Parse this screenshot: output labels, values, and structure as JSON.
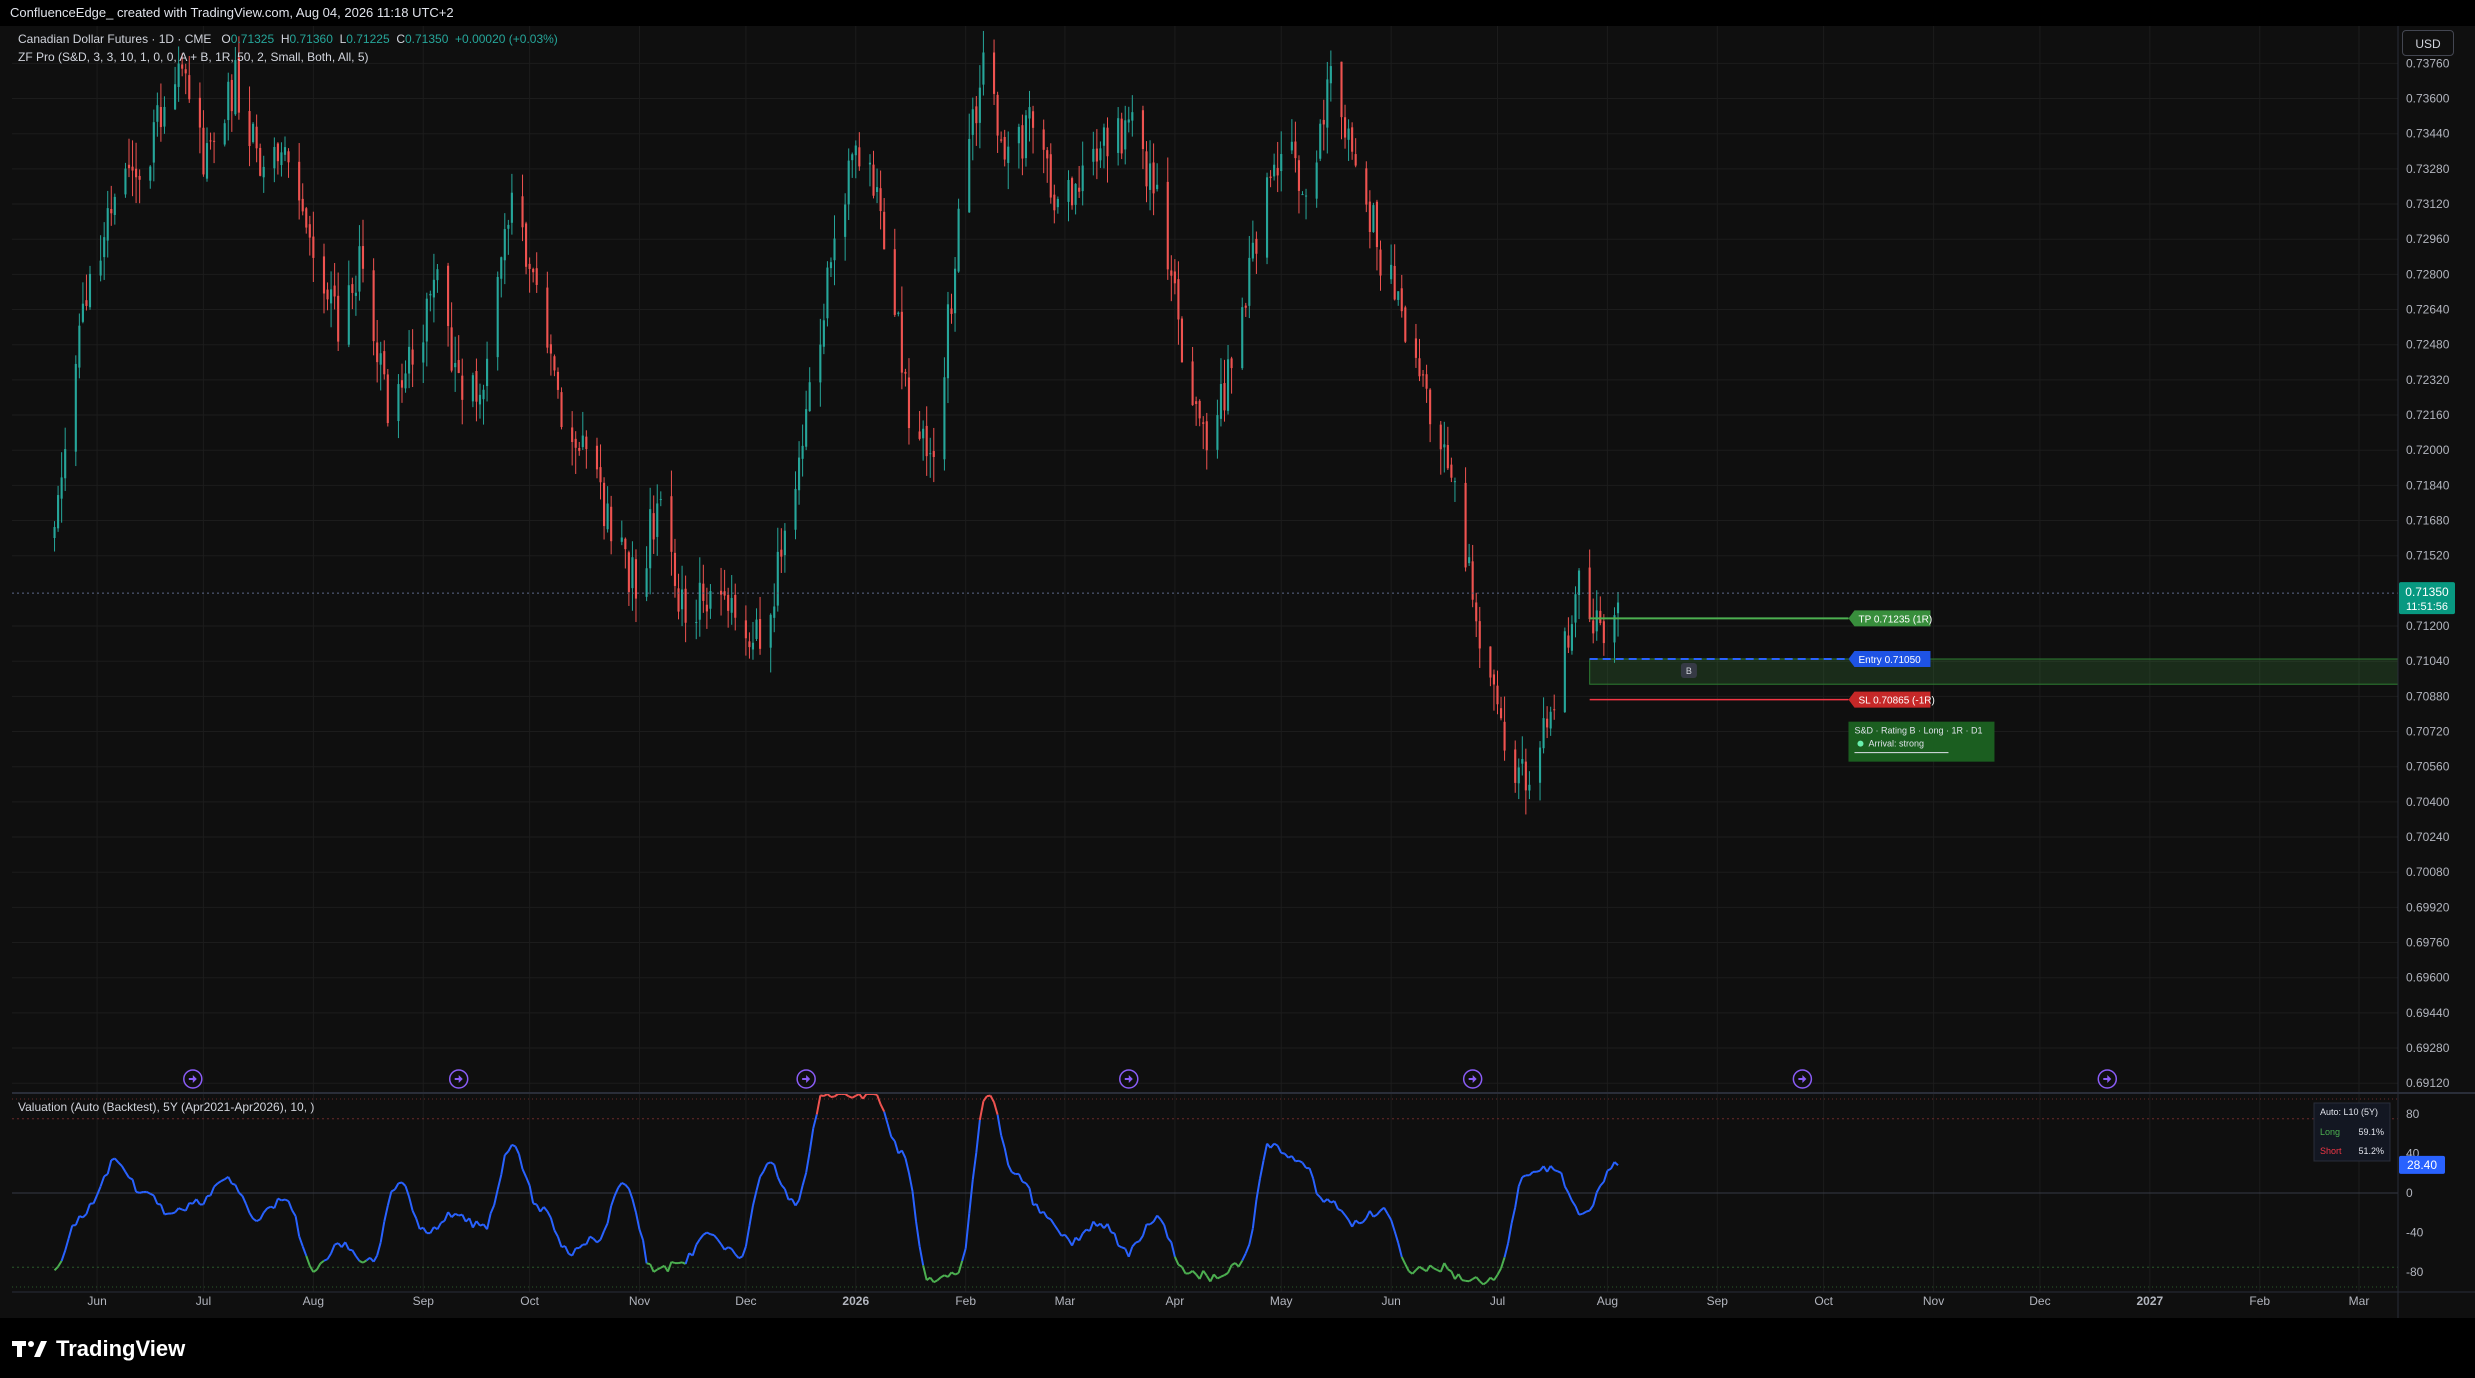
{
  "header": {
    "title": "ConfluenceEdge_ created with TradingView.com, Aug 04, 2026 11:18 UTC+2"
  },
  "legend": {
    "symbol": "Canadian Dollar Futures · 1D · CME",
    "o_label": "O",
    "o": "0.71325",
    "h_label": "H",
    "h": "0.71360",
    "l_label": "L",
    "l": "0.71225",
    "c_label": "C",
    "c": "0.71350",
    "change": "+0.00020 (+0.03%)",
    "indicator": "ZF Pro (S&D, 3, 3, 10, 1, 0, 0, A + B, 1R, 50, 2, Small, Both, All, 5)"
  },
  "currency_button": "USD",
  "footer": {
    "logo_text": "TradingView"
  },
  "colors": {
    "up": "#26a69a",
    "down": "#ef5350",
    "tp": "#4caf50",
    "entry": "#2962ff",
    "sl": "#f23645",
    "osc": "#2962ff",
    "accent": "#8a5cf6"
  },
  "chart_data": [
    {
      "type": "candlestick",
      "y_ticks": [
        "0.73760",
        "0.73600",
        "0.73440",
        "0.73280",
        "0.73120",
        "0.72960",
        "0.72800",
        "0.72640",
        "0.72480",
        "0.72320",
        "0.72160",
        "0.72000",
        "0.71840",
        "0.71680",
        "0.71520",
        "0.71200",
        "0.71040",
        "0.70880",
        "0.70720",
        "0.70560",
        "0.70400",
        "0.70240",
        "0.70080",
        "0.69920",
        "0.69760",
        "0.69600",
        "0.69440",
        "0.69280",
        "0.69120"
      ],
      "ylim": [
        0.6908,
        0.7393
      ],
      "current_price": "0.71350",
      "countdown": "11:51:56",
      "x_ticks": [
        "Jun",
        "Jul",
        "Aug",
        "Sep",
        "Oct",
        "Nov",
        "Dec",
        "2026",
        "Feb",
        "Mar",
        "Apr",
        "May",
        "Jun",
        "Jul",
        "Aug",
        "Sep",
        "Oct",
        "Nov",
        "Dec",
        "2027",
        "Feb",
        "Mar"
      ],
      "anchors": [
        [
          "2025-05-20",
          0.716
        ],
        [
          "2025-05-28",
          0.726
        ],
        [
          "2025-06-06",
          0.732
        ],
        [
          "2025-06-16",
          0.734
        ],
        [
          "2025-06-24",
          0.738
        ],
        [
          "2025-07-02",
          0.733
        ],
        [
          "2025-07-10",
          0.737
        ],
        [
          "2025-07-18",
          0.732
        ],
        [
          "2025-07-25",
          0.734
        ],
        [
          "2025-08-01",
          0.728
        ],
        [
          "2025-08-08",
          0.726
        ],
        [
          "2025-08-15",
          0.729
        ],
        [
          "2025-08-22",
          0.722
        ],
        [
          "2025-08-29",
          0.724
        ],
        [
          "2025-09-05",
          0.728
        ],
        [
          "2025-09-12",
          0.722
        ],
        [
          "2025-09-19",
          0.724
        ],
        [
          "2025-09-26",
          0.731
        ],
        [
          "2025-10-03",
          0.728
        ],
        [
          "2025-10-10",
          0.722
        ],
        [
          "2025-10-17",
          0.72
        ],
        [
          "2025-10-24",
          0.716
        ],
        [
          "2025-10-31",
          0.714
        ],
        [
          "2025-11-07",
          0.718
        ],
        [
          "2025-11-14",
          0.712
        ],
        [
          "2025-11-21",
          0.714
        ],
        [
          "2025-11-28",
          0.713
        ],
        [
          "2025-12-05",
          0.711
        ],
        [
          "2025-12-12",
          0.716
        ],
        [
          "2025-12-19",
          0.722
        ],
        [
          "2025-12-26",
          0.73
        ],
        [
          "2026-01-02",
          0.734
        ],
        [
          "2026-01-09",
          0.73
        ],
        [
          "2026-01-16",
          0.722
        ],
        [
          "2026-01-23",
          0.72
        ],
        [
          "2026-01-30",
          0.73
        ],
        [
          "2026-02-06",
          0.738
        ],
        [
          "2026-02-13",
          0.733
        ],
        [
          "2026-02-20",
          0.735
        ],
        [
          "2026-02-27",
          0.731
        ],
        [
          "2026-03-06",
          0.732
        ],
        [
          "2026-03-13",
          0.734
        ],
        [
          "2026-03-20",
          0.735
        ],
        [
          "2026-03-27",
          0.731
        ],
        [
          "2026-04-03",
          0.725
        ],
        [
          "2026-04-10",
          0.72
        ],
        [
          "2026-04-17",
          0.724
        ],
        [
          "2026-04-24",
          0.73
        ],
        [
          "2026-05-01",
          0.734
        ],
        [
          "2026-05-08",
          0.732
        ],
        [
          "2026-05-15",
          0.737
        ],
        [
          "2026-05-22",
          0.733
        ],
        [
          "2026-05-29",
          0.729
        ],
        [
          "2026-06-05",
          0.726
        ],
        [
          "2026-06-12",
          0.722
        ],
        [
          "2026-06-19",
          0.718
        ],
        [
          "2026-06-26",
          0.712
        ],
        [
          "2026-07-03",
          0.706
        ],
        [
          "2026-07-10",
          0.705
        ],
        [
          "2026-07-17",
          0.708
        ],
        [
          "2026-07-24",
          0.715
        ],
        [
          "2026-07-31",
          0.711
        ],
        [
          "2026-08-04",
          0.7135
        ]
      ],
      "trade": {
        "tp_label": "TP 0.71235 (1R)",
        "tp": 0.71235,
        "entry_label": "Entry 0.71050",
        "entry": 0.7105,
        "sl_label": "SL 0.70865 (-1R)",
        "sl": 0.70865,
        "zone_marker": "B",
        "info_title": "S&D · Rating B · Long · 1R · D1",
        "info_sub": "Arrival: strong"
      }
    },
    {
      "type": "line",
      "title": "Valuation (Auto (Backtest), 5Y (Apr2021-Apr2026), 10, )",
      "y_ticks": [
        "80",
        "40",
        "0",
        "-40",
        "-80"
      ],
      "ylim": [
        -100,
        100
      ],
      "overbought": 75,
      "oversold": -75,
      "current_value": "28.40",
      "stats": {
        "auto": "Auto: L10 (5Y)",
        "long_label": "Long",
        "long": "59.1%",
        "short_label": "Short",
        "short": "51.2%"
      },
      "anchors": [
        [
          "2025-05-20",
          -75
        ],
        [
          "2025-05-28",
          -20
        ],
        [
          "2025-06-06",
          30
        ],
        [
          "2025-06-14",
          0
        ],
        [
          "2025-06-22",
          -20
        ],
        [
          "2025-06-30",
          -10
        ],
        [
          "2025-07-08",
          15
        ],
        [
          "2025-07-16",
          -25
        ],
        [
          "2025-07-24",
          -5
        ],
        [
          "2025-08-01",
          -75
        ],
        [
          "2025-08-09",
          -50
        ],
        [
          "2025-08-17",
          -70
        ],
        [
          "2025-08-25",
          10
        ],
        [
          "2025-09-02",
          -40
        ],
        [
          "2025-09-10",
          -20
        ],
        [
          "2025-09-18",
          -35
        ],
        [
          "2025-09-26",
          45
        ],
        [
          "2025-10-04",
          -15
        ],
        [
          "2025-10-12",
          -60
        ],
        [
          "2025-10-20",
          -45
        ],
        [
          "2025-10-28",
          10
        ],
        [
          "2025-11-05",
          -80
        ],
        [
          "2025-11-13",
          -70
        ],
        [
          "2025-11-21",
          -40
        ],
        [
          "2025-11-29",
          -65
        ],
        [
          "2025-12-07",
          30
        ],
        [
          "2025-12-15",
          -10
        ],
        [
          "2025-12-23",
          100
        ],
        [
          "2026-01-06",
          100
        ],
        [
          "2026-01-14",
          40
        ],
        [
          "2026-01-22",
          -90
        ],
        [
          "2026-01-30",
          -80
        ],
        [
          "2026-02-07",
          100
        ],
        [
          "2026-02-15",
          20
        ],
        [
          "2026-02-23",
          -20
        ],
        [
          "2026-03-03",
          -50
        ],
        [
          "2026-03-11",
          -30
        ],
        [
          "2026-03-19",
          -60
        ],
        [
          "2026-03-27",
          -25
        ],
        [
          "2026-04-04",
          -80
        ],
        [
          "2026-04-12",
          -85
        ],
        [
          "2026-04-20",
          -70
        ],
        [
          "2026-04-28",
          50
        ],
        [
          "2026-05-06",
          35
        ],
        [
          "2026-05-14",
          -10
        ],
        [
          "2026-05-22",
          -30
        ],
        [
          "2026-05-30",
          -15
        ],
        [
          "2026-06-07",
          -80
        ],
        [
          "2026-06-15",
          -75
        ],
        [
          "2026-06-23",
          -90
        ],
        [
          "2026-07-01",
          -85
        ],
        [
          "2026-07-09",
          20
        ],
        [
          "2026-07-17",
          25
        ],
        [
          "2026-07-25",
          -20
        ],
        [
          "2026-08-04",
          28
        ]
      ]
    }
  ]
}
